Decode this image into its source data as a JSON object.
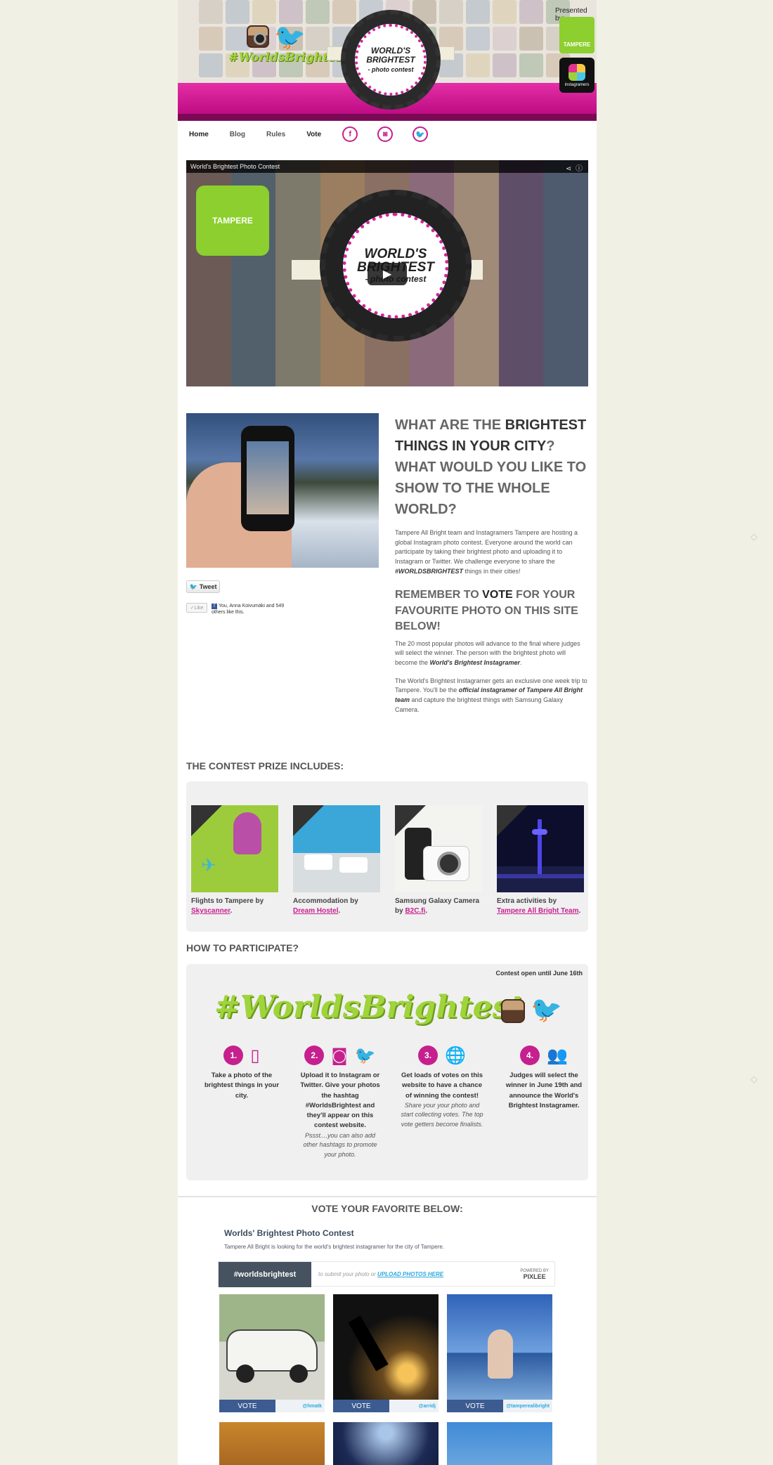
{
  "header": {
    "hashtag": "#WorldsBrightest",
    "badge_title": "WORLD'S BRIGHTEST",
    "badge_sub": "- photo contest",
    "presented_by": "Presented by:",
    "partner_tampere": "TAMPERE",
    "partner_igers": "instagramers"
  },
  "nav": {
    "items": [
      {
        "label": "Home"
      },
      {
        "label": "Blog"
      },
      {
        "label": "Rules"
      },
      {
        "label": "Vote"
      }
    ]
  },
  "video": {
    "title": "World's Brightest Photo Contest",
    "badge_title": "WORLD'S BRIGHTEST",
    "badge_sub": "- photo contest",
    "overlay_logo": "TAMPERE"
  },
  "social": {
    "tweet_label": "Tweet",
    "like_label": "Like",
    "like_text": "You, Anna Koivumäki and 549 others like this."
  },
  "intro": {
    "heading_a": "WHAT ARE THE ",
    "heading_b": "BRIGHTEST THINGS IN YOUR CITY",
    "heading_c": "? WHAT WOULD YOU LIKE TO SHOW TO THE WHOLE WORLD?",
    "p1_a": "Tampere All Bright team and Instagramers Tampere are hosting a global Instagram photo contest. Everyone around the world can participate by taking their brightest photo and uploading it to Instagram or Twitter. We challenge everyone to share the ",
    "p1_hashtag": "#WORLDSBRIGHTEST",
    "p1_b": " things in their cities!",
    "h2_a": "REMEMBER TO ",
    "h2_b": "VOTE",
    "h2_c": " FOR YOUR FAVOURITE PHOTO ON THIS SITE BELOW!",
    "p2_a": "The 20 most popular photos will advance to the final where judges will select the winner. The person with the brightest photo will become the ",
    "p2_b": "World's Brightest Instagramer",
    "p2_c": ".",
    "p3_a": "The World's Brightest Instagramer gets an exclusive one week trip to Tampere. You'll be the ",
    "p3_b": "official instagramer of Tampere All Bright team",
    "p3_c": " and capture the brightest things with Samsung Galaxy Camera."
  },
  "prize": {
    "title": "THE CONTEST PRIZE INCLUDES:",
    "items": [
      {
        "text": "Flights to Tampere by ",
        "link": "Skyscanner",
        "end": "."
      },
      {
        "text": "Accommodation by ",
        "link": "Dream Hostel",
        "end": "."
      },
      {
        "text": "Samsung Galaxy Camera by ",
        "link": "B2C.fi",
        "end": "."
      },
      {
        "text": "Extra activities by ",
        "link": "Tampere All Bright Team",
        "end": "."
      }
    ]
  },
  "participate": {
    "title": "HOW TO PARTICIPATE?",
    "open_until": "Contest open until June 16th",
    "hashtag": "#WorldsBrightest",
    "steps": [
      {
        "num": "1.",
        "text": "Take a photo of the brightest things in your city.",
        "note": ""
      },
      {
        "num": "2.",
        "text": "Upload it to Instagram or Twitter. Give your photos the hashtag #WorldsBrightest and they'll appear on this contest website.",
        "note": "Pssst....you can also add other hashtags to promote your photo."
      },
      {
        "num": "3.",
        "text": "Get loads of votes on this website to have a chance of winning the contest!",
        "note": "Share your your photo and start collecting votes. The top vote getters become finalists."
      },
      {
        "num": "4.",
        "text": "Judges will select the winner in June 19th and announce the World's Brightest Instagramer.",
        "note": ""
      }
    ]
  },
  "vote": {
    "title": "VOTE YOUR FAVORITE BELOW:",
    "widget_title": "Worlds' Brightest Photo Contest",
    "widget_sub": "Tampere All Bright is looking for the world's brightest instagramer for the city of Tampere.",
    "tag_button": "#worldsbrightest",
    "submit_prefix": "to submit your photo or ",
    "upload_label": "UPLOAD PHOTOS HERE",
    "powered_by": "POWERED BY",
    "powered_brand": "PIXLEE",
    "photos": [
      {
        "vote": "VOTE",
        "handle": "@hmatk"
      },
      {
        "vote": "VOTE",
        "handle": "@arridj"
      },
      {
        "vote": "VOTE",
        "handle": "@tamperealibright"
      }
    ]
  }
}
